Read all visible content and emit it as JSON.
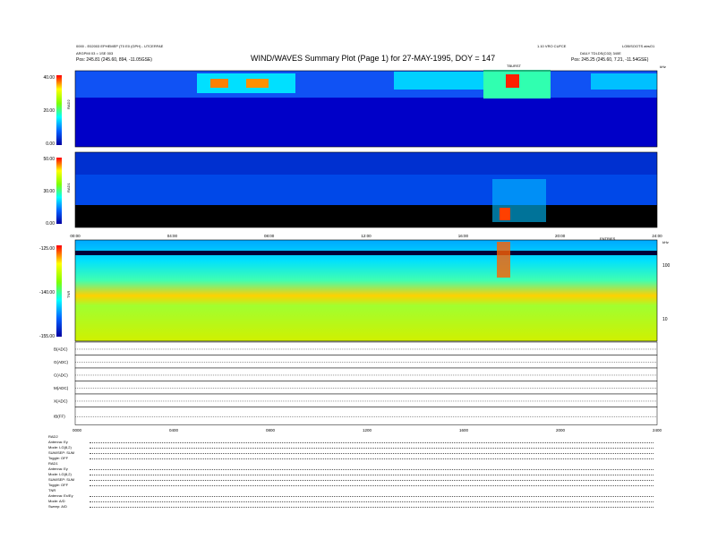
{
  "header": {
    "title": "WIND/WAVES Summary Plot (Page 1) for 27-MAY-1995, DOY = 147",
    "left_line1": "0000 - E02003 EPHEMEP (T0 E0 (GPH) - UTCERFAE",
    "left_line2": "ARGPMI 03 = 1SE 003",
    "left_line3": "Pos: 245.81 (245.60, 894, -11.05GSE)",
    "right_line1": "LOB/SOOTS atrsO1",
    "right_line2": "DAILY TDLDS(C02) 340E",
    "right_line3": "Pos: 245.25 (245.60, 7.21, -11.54GSE)",
    "center_small": "1.10 VRO CUFCE",
    "marker_top": "TBURST"
  },
  "panels": {
    "rad2": {
      "name": "RAD2",
      "ticks": [
        "40.00",
        "20.00",
        "0.00"
      ]
    },
    "rad1": {
      "name": "RAD1",
      "ticks": [
        "50.00",
        "30.00",
        "0.00"
      ]
    },
    "tnr": {
      "name": "TNR",
      "ticks": [
        "-125.00",
        "-140.00",
        "-155.00"
      ],
      "right_ticks": [
        "100",
        "10"
      ],
      "right_unit": "kHz",
      "top_label": "ENTRIES"
    },
    "rad_time_ticks": [
      "00:00",
      "04:00",
      "08:00",
      "12:00",
      "16:00",
      "20:00",
      "24:00"
    ],
    "line_time_ticks": [
      "0000",
      "0400",
      "0800",
      "1200",
      "1600",
      "2000",
      "2400"
    ],
    "line_labels": [
      "B(ADC)",
      "G(ADC)",
      "C(ADC)",
      "M(ADC)",
      "X(ADC)",
      "IB(FF)"
    ],
    "rad2_unit": "kHz"
  },
  "footer": {
    "blocks": [
      {
        "head": "RAD2",
        "rows": [
          [
            "Antenna:",
            "Ey"
          ],
          [
            "Mode:",
            "LG(8,2)"
          ],
          [
            "SUM/SEP:",
            "SUM"
          ],
          [
            "Toggle:",
            "OFF"
          ]
        ]
      },
      {
        "head": "RAD1",
        "rows": [
          [
            "Antenna:",
            "Ey"
          ],
          [
            "Mode:",
            "LG(8,2)"
          ],
          [
            "SUM/SEP:",
            "SUM"
          ],
          [
            "Toggle:",
            "OFF"
          ]
        ]
      },
      {
        "head": "TNR",
        "rows": [
          [
            "Antenna:",
            "Ex/Ey"
          ],
          [
            "Mode:",
            "A/D"
          ],
          [
            "Sweep:",
            "A/D"
          ]
        ]
      }
    ]
  },
  "colors": {
    "background": "#0000c8",
    "medium": "#1a6aff",
    "high": "#00ffff",
    "peak": "#ff0000",
    "tnr_base": "#cde800"
  }
}
